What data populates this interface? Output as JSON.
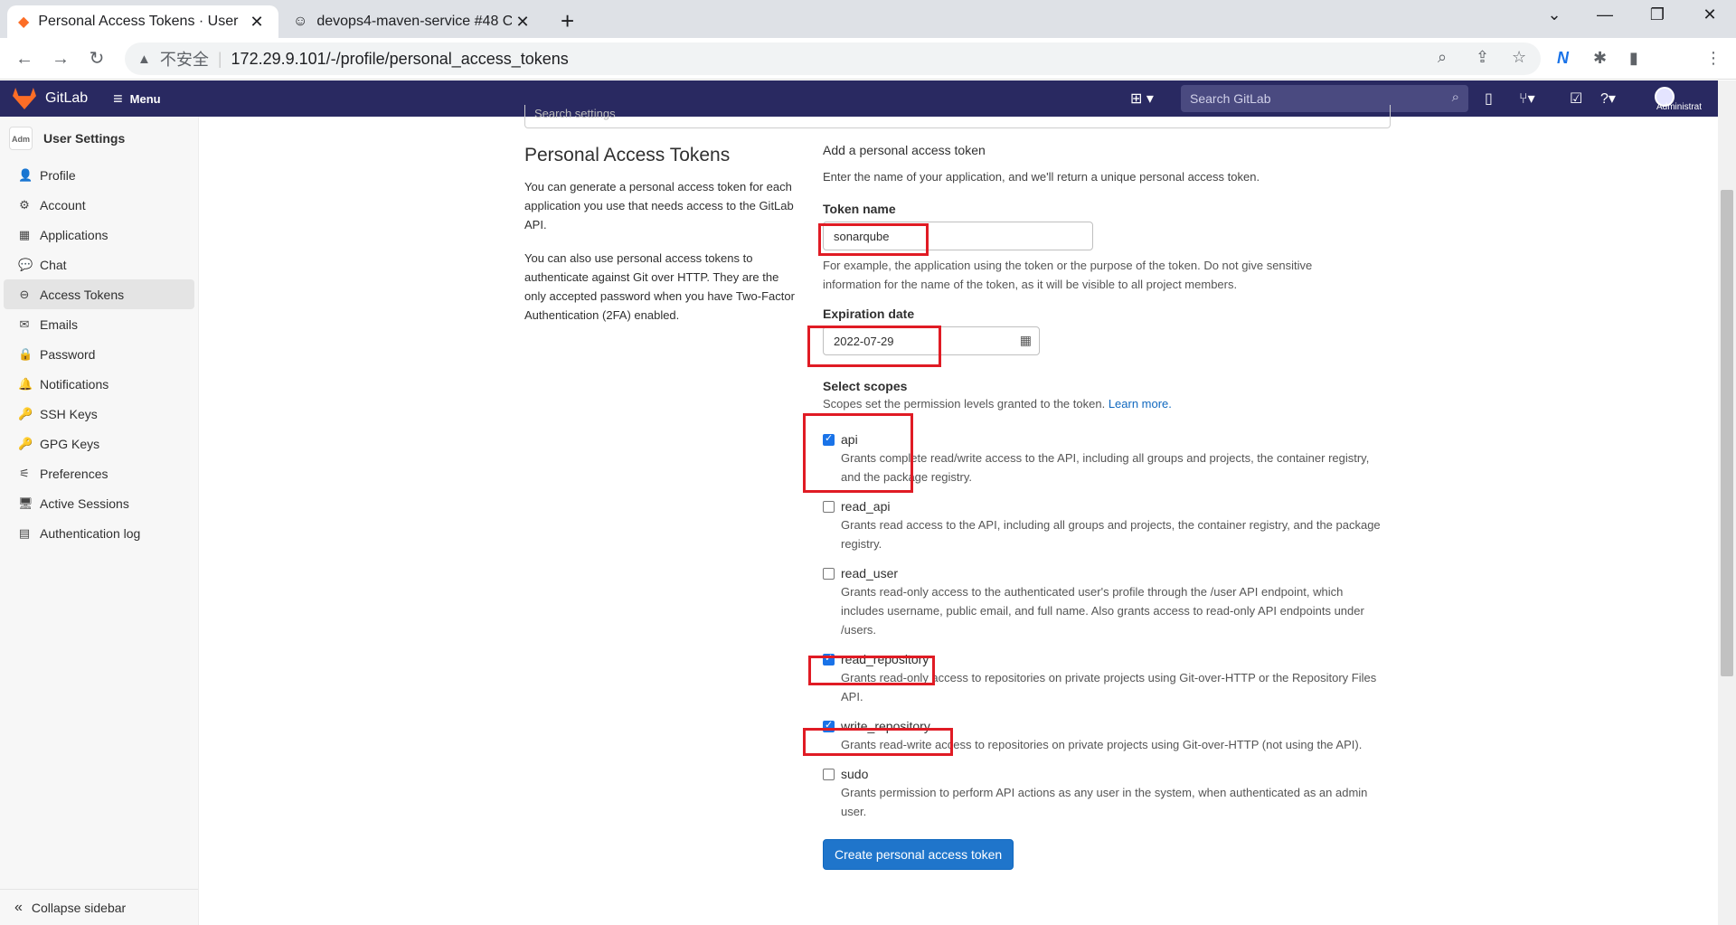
{
  "browser": {
    "tabs": [
      {
        "title": "Personal Access Tokens · User",
        "close": "✕"
      },
      {
        "title": "devops4-maven-service #48 C",
        "close": "✕"
      }
    ],
    "new_tab": "+",
    "insecure_label": "不安全",
    "url": "172.29.9.101/-/profile/personal_access_tokens"
  },
  "gitlab": {
    "brand": "GitLab",
    "menu_label": "Menu",
    "search_placeholder": "Search GitLab",
    "admin_label": "Administrat"
  },
  "sidebar": {
    "avatar_text": "Adm",
    "title": "User Settings",
    "items": [
      {
        "label": "Profile",
        "icon": "👤"
      },
      {
        "label": "Account",
        "icon": "⚙"
      },
      {
        "label": "Applications",
        "icon": "▦"
      },
      {
        "label": "Chat",
        "icon": "💬"
      },
      {
        "label": "Access Tokens",
        "icon": "⊖"
      },
      {
        "label": "Emails",
        "icon": "✉"
      },
      {
        "label": "Password",
        "icon": "🔒"
      },
      {
        "label": "Notifications",
        "icon": "🔔"
      },
      {
        "label": "SSH Keys",
        "icon": "🔑"
      },
      {
        "label": "GPG Keys",
        "icon": "🔑"
      },
      {
        "label": "Preferences",
        "icon": "⚟"
      },
      {
        "label": "Active Sessions",
        "icon": "🖥"
      },
      {
        "label": "Authentication log",
        "icon": "▤"
      }
    ],
    "collapse_label": "Collapse sidebar"
  },
  "search_settings_placeholder": "Search settings",
  "intro": {
    "title": "Personal Access Tokens",
    "p1": "You can generate a personal access token for each application you use that needs access to the GitLab API.",
    "p2": "You can also use personal access tokens to authenticate against Git over HTTP. They are the only accepted password when you have Two-Factor Authentication (2FA) enabled."
  },
  "form": {
    "heading": "Add a personal access token",
    "lead": "Enter the name of your application, and we'll return a unique personal access token.",
    "token_name_label": "Token name",
    "token_name_value": "sonarqube",
    "token_name_help": "For example, the application using the token or the purpose of the token. Do not give sensitive information for the name of the token, as it will be visible to all project members.",
    "expiration_label": "Expiration date",
    "expiration_value": "2022-07-29",
    "scopes_label": "Select scopes",
    "scopes_help": "Scopes set the permission levels granted to the token.",
    "learn_more": "Learn more.",
    "scopes": [
      {
        "name": "api",
        "checked": true,
        "desc": "Grants complete read/write access to the API, including all groups and projects, the container registry, and the package registry."
      },
      {
        "name": "read_api",
        "checked": false,
        "desc": "Grants read access to the API, including all groups and projects, the container registry, and the package registry."
      },
      {
        "name": "read_user",
        "checked": false,
        "desc": "Grants read-only access to the authenticated user's profile through the /user API endpoint, which includes username, public email, and full name. Also grants access to read-only API endpoints under /users."
      },
      {
        "name": "read_repository",
        "checked": true,
        "desc": "Grants read-only access to repositories on private projects using Git-over-HTTP or the Repository Files API."
      },
      {
        "name": "write_repository",
        "checked": true,
        "desc": "Grants read-write access to repositories on private projects using Git-over-HTTP (not using the API)."
      },
      {
        "name": "sudo",
        "checked": false,
        "desc": "Grants permission to perform API actions as any user in the system, when authenticated as an admin user."
      }
    ],
    "submit_label": "Create personal access token"
  },
  "colors": {
    "gitlab_nav": "#292961",
    "primary_button": "#1f75cb",
    "annotation_red": "#e01b24"
  }
}
